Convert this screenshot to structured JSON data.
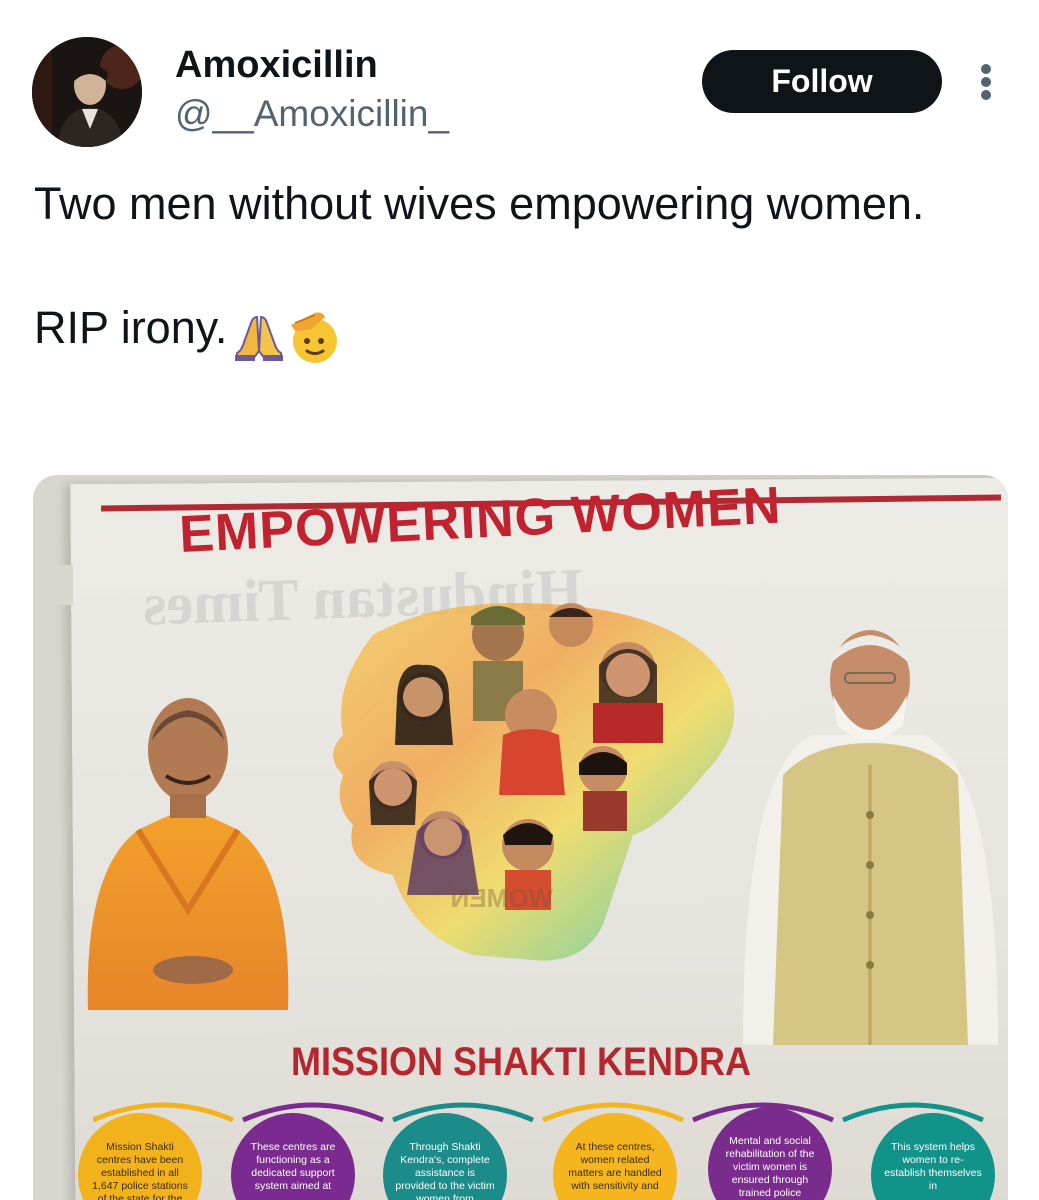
{
  "post": {
    "display_name": "Amoxicillin",
    "handle": "@__Amoxicillin_",
    "follow_label": "Follow",
    "text_line1": "Two men without wives empowering women.",
    "text_line2": "RIP irony.",
    "emojis": [
      "folded-hands-emoji",
      "saluting-face-emoji"
    ]
  },
  "media": {
    "headline": "EMPOWERING WOMEN",
    "subheadline": "MISSION SHAKTI KENDRA",
    "info_bubbles": [
      {
        "text": "Mission Shakti centres have been established in all 1,647 police stations of the state for the safety",
        "color": "#f2b21c"
      },
      {
        "text": "These centres are functioning as a dedicated support system aimed at",
        "color": "#7b2a8f"
      },
      {
        "text": "Through Shakti Kendra's, complete assistance is provided to the victim women from",
        "color": "#1b8c8a"
      },
      {
        "text": "At these centres, women related matters are handled with sensitivity and",
        "color": "#f4b51e"
      },
      {
        "text": "Mental and social rehabilitation of the victim women is ensured through trained police",
        "color": "#7a2c8c"
      },
      {
        "text": "This system helps women to re-establish themselves in",
        "color": "#12938a"
      }
    ]
  },
  "colors": {
    "text_primary": "#0f1419",
    "text_secondary": "#536471",
    "follow_bg": "#0f1419",
    "headline_red": "#c0232f"
  }
}
